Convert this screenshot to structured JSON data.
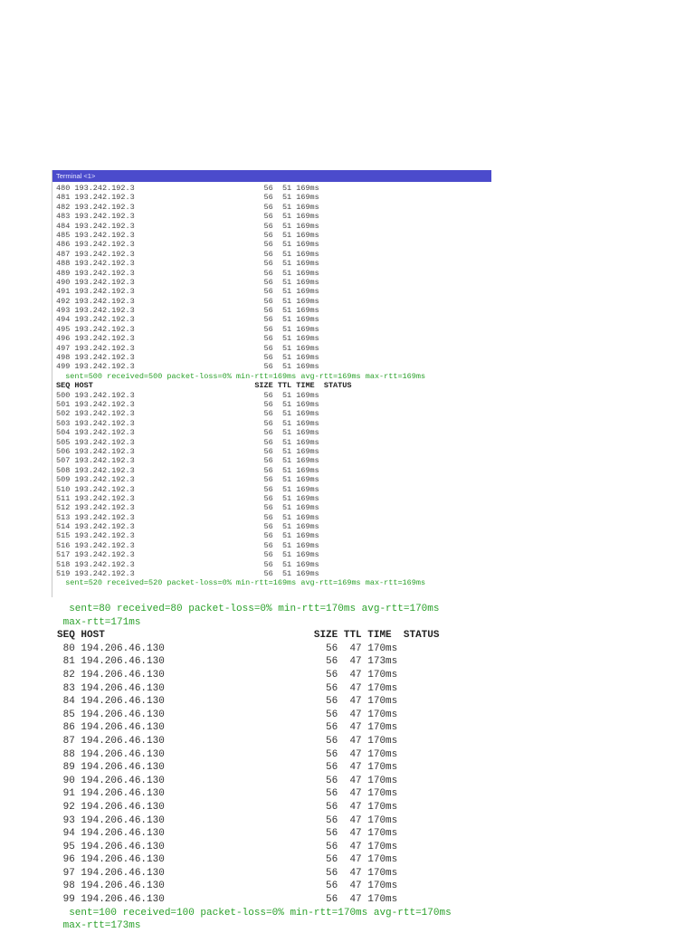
{
  "terminal": {
    "title": "Terminal <1>",
    "header": {
      "seq": "SEQ",
      "host": "HOST",
      "size": "SIZE",
      "ttl": "TTL",
      "time": "TIME",
      "status": "STATUS"
    },
    "block1_rows": [
      [
        "480",
        "193.242.192.3",
        "56",
        "51",
        "169ms"
      ],
      [
        "481",
        "193.242.192.3",
        "56",
        "51",
        "169ms"
      ],
      [
        "482",
        "193.242.192.3",
        "56",
        "51",
        "169ms"
      ],
      [
        "483",
        "193.242.192.3",
        "56",
        "51",
        "169ms"
      ],
      [
        "484",
        "193.242.192.3",
        "56",
        "51",
        "169ms"
      ],
      [
        "485",
        "193.242.192.3",
        "56",
        "51",
        "169ms"
      ],
      [
        "486",
        "193.242.192.3",
        "56",
        "51",
        "169ms"
      ],
      [
        "487",
        "193.242.192.3",
        "56",
        "51",
        "169ms"
      ],
      [
        "488",
        "193.242.192.3",
        "56",
        "51",
        "169ms"
      ],
      [
        "489",
        "193.242.192.3",
        "56",
        "51",
        "169ms"
      ],
      [
        "490",
        "193.242.192.3",
        "56",
        "51",
        "169ms"
      ],
      [
        "491",
        "193.242.192.3",
        "56",
        "51",
        "169ms"
      ],
      [
        "492",
        "193.242.192.3",
        "56",
        "51",
        "169ms"
      ],
      [
        "493",
        "193.242.192.3",
        "56",
        "51",
        "169ms"
      ],
      [
        "494",
        "193.242.192.3",
        "56",
        "51",
        "169ms"
      ],
      [
        "495",
        "193.242.192.3",
        "56",
        "51",
        "169ms"
      ],
      [
        "496",
        "193.242.192.3",
        "56",
        "51",
        "169ms"
      ],
      [
        "497",
        "193.242.192.3",
        "56",
        "51",
        "169ms"
      ],
      [
        "498",
        "193.242.192.3",
        "56",
        "51",
        "169ms"
      ],
      [
        "499",
        "193.242.192.3",
        "56",
        "51",
        "169ms"
      ]
    ],
    "block1_summary": "sent=500 received=500 packet-loss=0% min-rtt=169ms avg-rtt=169ms max-rtt=169ms",
    "block2_rows": [
      [
        "500",
        "193.242.192.3",
        "56",
        "51",
        "169ms"
      ],
      [
        "501",
        "193.242.192.3",
        "56",
        "51",
        "169ms"
      ],
      [
        "502",
        "193.242.192.3",
        "56",
        "51",
        "169ms"
      ],
      [
        "503",
        "193.242.192.3",
        "56",
        "51",
        "169ms"
      ],
      [
        "504",
        "193.242.192.3",
        "56",
        "51",
        "169ms"
      ],
      [
        "505",
        "193.242.192.3",
        "56",
        "51",
        "169ms"
      ],
      [
        "506",
        "193.242.192.3",
        "56",
        "51",
        "169ms"
      ],
      [
        "507",
        "193.242.192.3",
        "56",
        "51",
        "169ms"
      ],
      [
        "508",
        "193.242.192.3",
        "56",
        "51",
        "169ms"
      ],
      [
        "509",
        "193.242.192.3",
        "56",
        "51",
        "169ms"
      ],
      [
        "510",
        "193.242.192.3",
        "56",
        "51",
        "169ms"
      ],
      [
        "511",
        "193.242.192.3",
        "56",
        "51",
        "169ms"
      ],
      [
        "512",
        "193.242.192.3",
        "56",
        "51",
        "169ms"
      ],
      [
        "513",
        "193.242.192.3",
        "56",
        "51",
        "169ms"
      ],
      [
        "514",
        "193.242.192.3",
        "56",
        "51",
        "169ms"
      ],
      [
        "515",
        "193.242.192.3",
        "56",
        "51",
        "169ms"
      ],
      [
        "516",
        "193.242.192.3",
        "56",
        "51",
        "169ms"
      ],
      [
        "517",
        "193.242.192.3",
        "56",
        "51",
        "169ms"
      ],
      [
        "518",
        "193.242.192.3",
        "56",
        "51",
        "169ms"
      ],
      [
        "519",
        "193.242.192.3",
        "56",
        "51",
        "169ms"
      ]
    ],
    "block2_summary": "sent=520 received=520 packet-loss=0% min-rtt=169ms avg-rtt=169ms max-rtt=169ms"
  },
  "lower": {
    "summary_top_1": "sent=80 received=80 packet-loss=0% min-rtt=170ms avg-rtt=170ms",
    "summary_top_2": "max-rtt=171ms",
    "rows": [
      [
        "80",
        "194.206.46.130",
        "56",
        "47",
        "170ms"
      ],
      [
        "81",
        "194.206.46.130",
        "56",
        "47",
        "173ms"
      ],
      [
        "82",
        "194.206.46.130",
        "56",
        "47",
        "170ms"
      ],
      [
        "83",
        "194.206.46.130",
        "56",
        "47",
        "170ms"
      ],
      [
        "84",
        "194.206.46.130",
        "56",
        "47",
        "170ms"
      ],
      [
        "85",
        "194.206.46.130",
        "56",
        "47",
        "170ms"
      ],
      [
        "86",
        "194.206.46.130",
        "56",
        "47",
        "170ms"
      ],
      [
        "87",
        "194.206.46.130",
        "56",
        "47",
        "170ms"
      ],
      [
        "88",
        "194.206.46.130",
        "56",
        "47",
        "170ms"
      ],
      [
        "89",
        "194.206.46.130",
        "56",
        "47",
        "170ms"
      ],
      [
        "90",
        "194.206.46.130",
        "56",
        "47",
        "170ms"
      ],
      [
        "91",
        "194.206.46.130",
        "56",
        "47",
        "170ms"
      ],
      [
        "92",
        "194.206.46.130",
        "56",
        "47",
        "170ms"
      ],
      [
        "93",
        "194.206.46.130",
        "56",
        "47",
        "170ms"
      ],
      [
        "94",
        "194.206.46.130",
        "56",
        "47",
        "170ms"
      ],
      [
        "95",
        "194.206.46.130",
        "56",
        "47",
        "170ms"
      ],
      [
        "96",
        "194.206.46.130",
        "56",
        "47",
        "170ms"
      ],
      [
        "97",
        "194.206.46.130",
        "56",
        "47",
        "170ms"
      ],
      [
        "98",
        "194.206.46.130",
        "56",
        "47",
        "170ms"
      ],
      [
        "99",
        "194.206.46.130",
        "56",
        "47",
        "170ms"
      ]
    ],
    "summary_bottom_1": "sent=100 received=100 packet-loss=0% min-rtt=170ms avg-rtt=170ms",
    "summary_bottom_2": "max-rtt=173ms"
  }
}
